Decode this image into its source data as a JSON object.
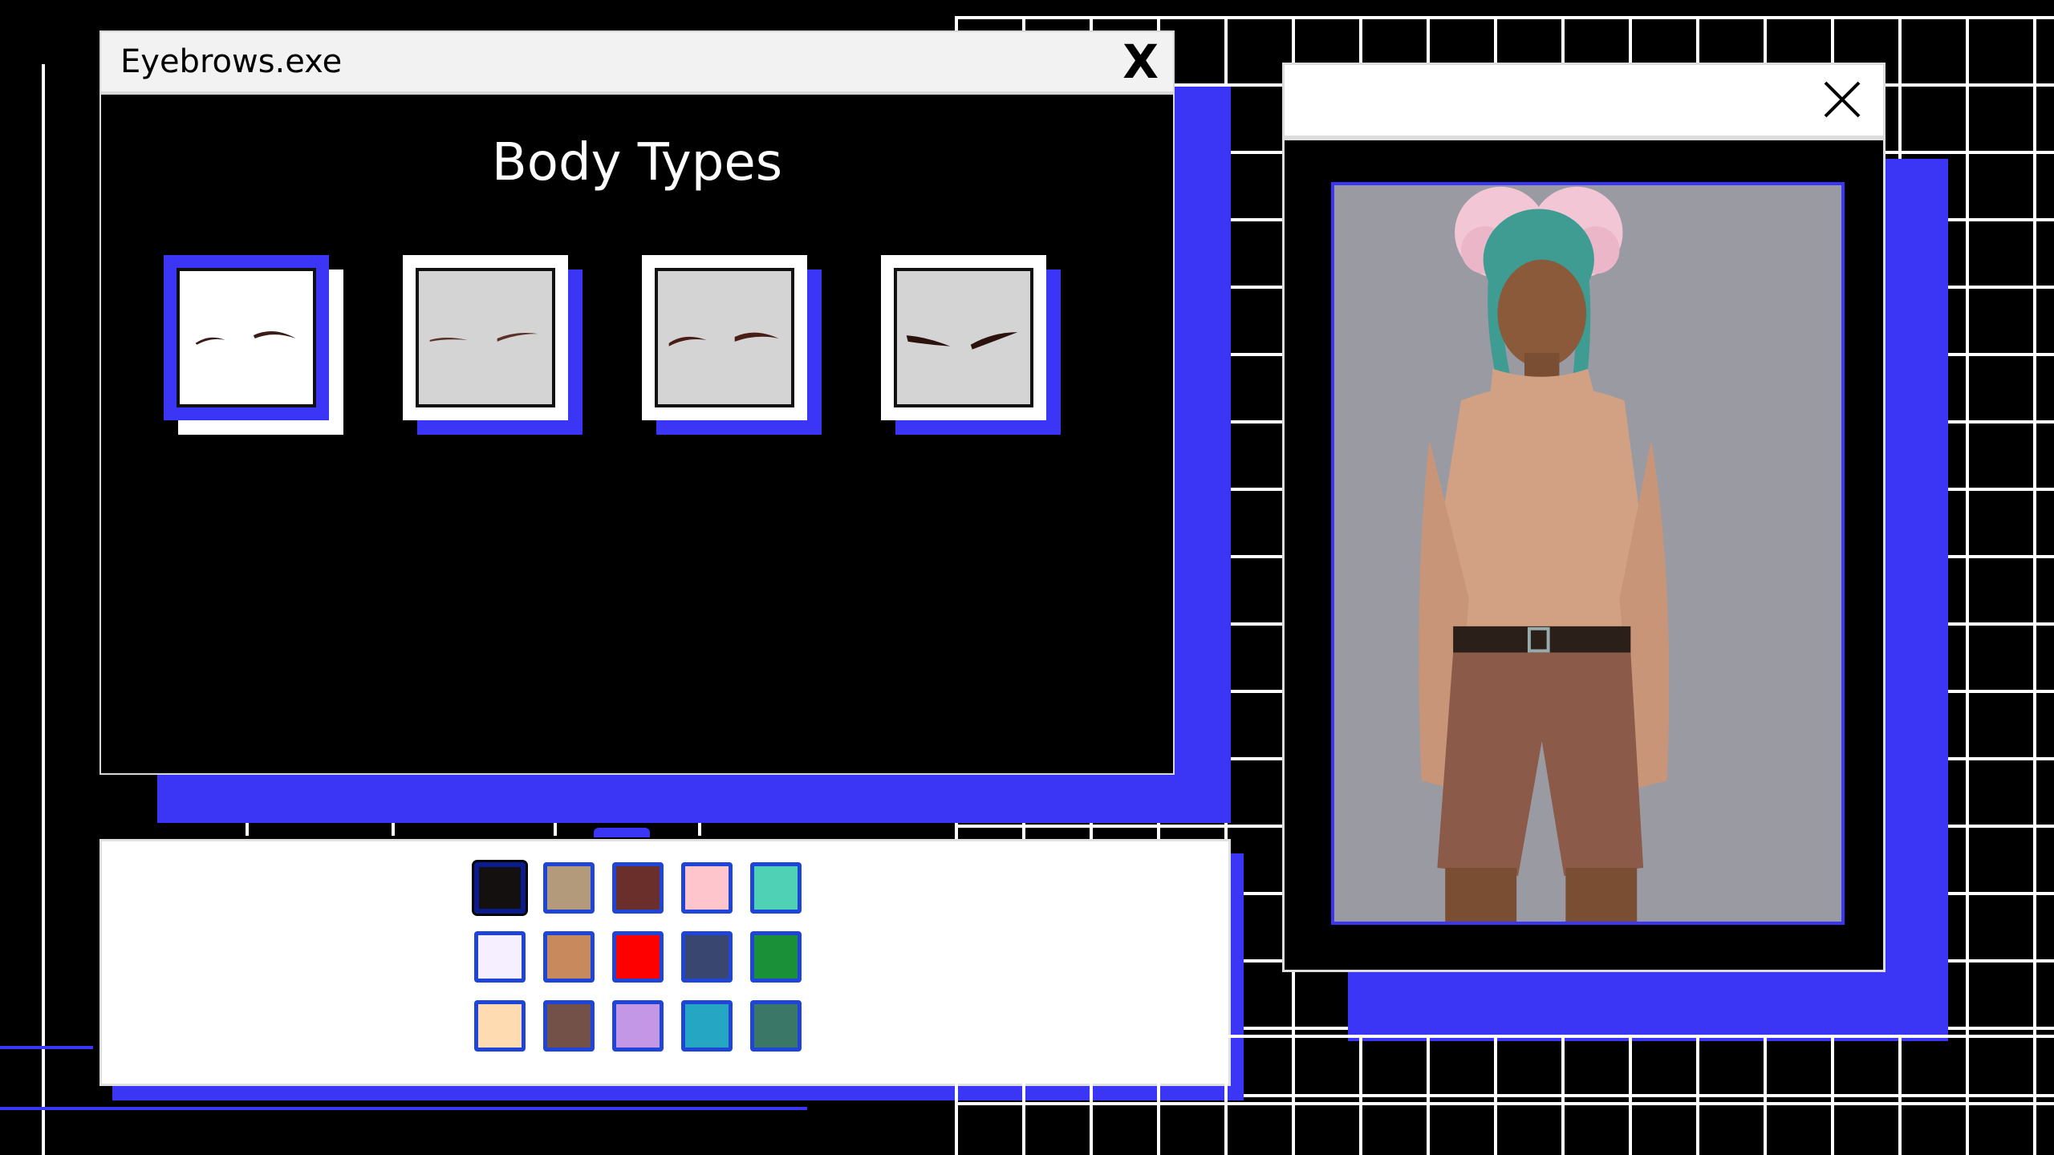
{
  "window": {
    "title": "Eyebrows.exe",
    "close_label": "X",
    "heading": "Body Types"
  },
  "options": [
    {
      "id": "brow-thin-arch",
      "selected": true
    },
    {
      "id": "brow-soft-flat",
      "selected": false
    },
    {
      "id": "brow-medium",
      "selected": false
    },
    {
      "id": "brow-thick-angled",
      "selected": false
    }
  ],
  "palette": {
    "colors": [
      [
        "#141010",
        "#b39a7a",
        "#6b2f2b",
        "#ffc5cc",
        "#4fd1b5"
      ],
      [
        "#f5efff",
        "#c88a5c",
        "#ff0000",
        "#394670",
        "#1a9138"
      ],
      [
        "#fedbb0",
        "#735148",
        "#c497e6",
        "#25a6c3",
        "#3b7767"
      ]
    ],
    "selected": [
      0,
      0
    ]
  },
  "colors": {
    "accent_blue": "#3b36f5",
    "grid": "#ffffff",
    "portrait_bg": "#9a9aa3"
  },
  "preview": {
    "close_icon": "close-icon"
  }
}
